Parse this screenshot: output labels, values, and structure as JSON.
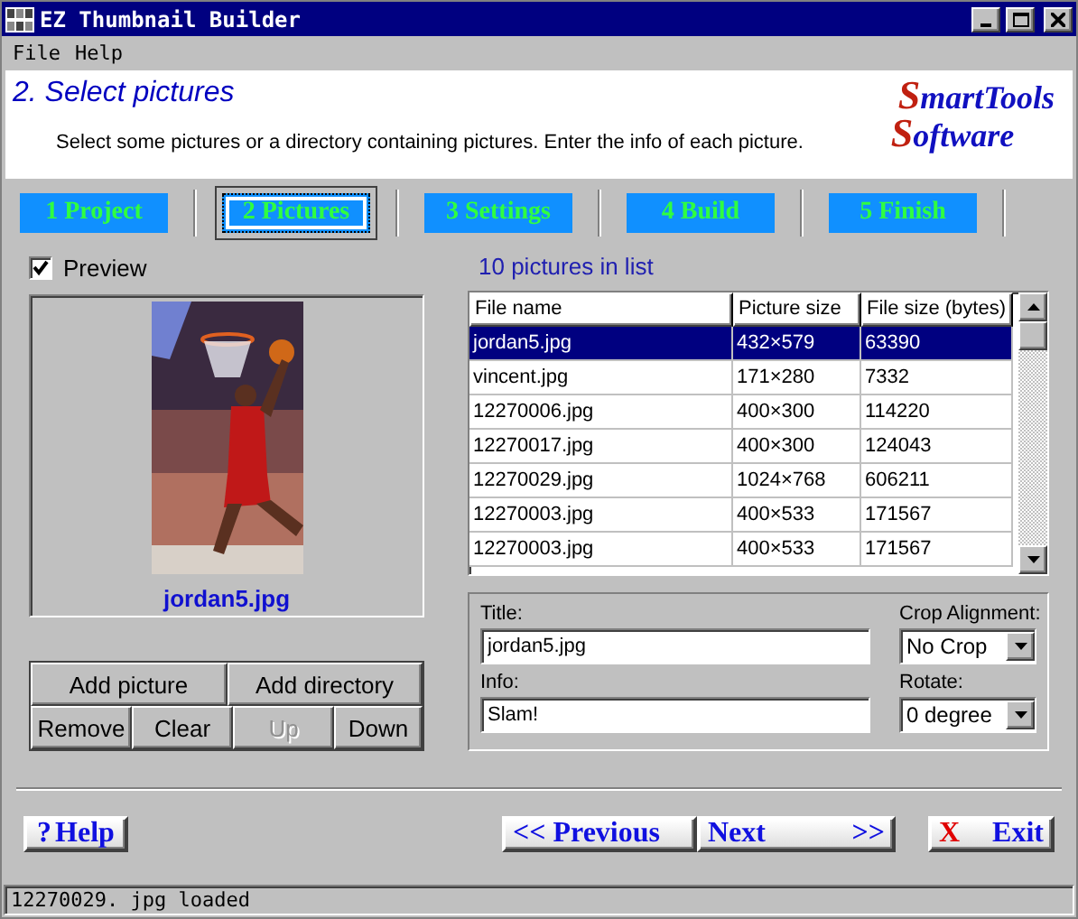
{
  "window": {
    "title": "EZ Thumbnail Builder"
  },
  "menu": [
    "File",
    "Help"
  ],
  "header": {
    "title": "2. Select pictures",
    "subtitle": "Select some pictures or a directory containing pictures. Enter the info of each picture.",
    "logo": [
      "SmartTools",
      "Software"
    ]
  },
  "tabs": [
    {
      "label": "1 Project",
      "selected": false
    },
    {
      "label": "2 Pictures",
      "selected": true
    },
    {
      "label": "3 Settings",
      "selected": false
    },
    {
      "label": "4 Build",
      "selected": false
    },
    {
      "label": "5 Finish",
      "selected": false
    }
  ],
  "preview": {
    "label": "Preview",
    "checked": true,
    "caption": "jordan5.jpg"
  },
  "list_buttons": [
    {
      "label": "Add picture",
      "disabled": false
    },
    {
      "label": "Add directory",
      "disabled": false
    }
  ],
  "order_buttons": [
    {
      "label": "Remove",
      "disabled": false
    },
    {
      "label": "Clear",
      "disabled": false
    },
    {
      "label": "Up",
      "disabled": true
    },
    {
      "label": "Down",
      "disabled": false
    }
  ],
  "count": "10 pictures in list",
  "table": {
    "columns": [
      "File name",
      "Picture size",
      "File size (bytes)"
    ],
    "rows": [
      {
        "cells": [
          "jordan5.jpg",
          "432×579",
          "63390"
        ],
        "selected": true
      },
      {
        "cells": [
          "vincent.jpg",
          "171×280",
          "7332"
        ],
        "selected": false
      },
      {
        "cells": [
          "12270006.jpg",
          "400×300",
          "114220"
        ],
        "selected": false
      },
      {
        "cells": [
          "12270017.jpg",
          "400×300",
          "124043"
        ],
        "selected": false
      },
      {
        "cells": [
          "12270029.jpg",
          "1024×768",
          "606211"
        ],
        "selected": false
      },
      {
        "cells": [
          "12270003.jpg",
          "400×533",
          "171567"
        ],
        "selected": false
      },
      {
        "cells": [
          "12270003.jpg",
          "400×533",
          "171567"
        ],
        "selected": false
      }
    ]
  },
  "form": {
    "title_label": "Title:",
    "title_value": "jordan5.jpg",
    "info_label": "Info:",
    "info_value": "Slam!",
    "crop_label": "Crop Alignment:",
    "crop_value": "No Crop",
    "rotate_label": "Rotate:",
    "rotate_value": "0 degree"
  },
  "nav": {
    "help": {
      "icon": "?",
      "label": "Help"
    },
    "previous": "<< Previous",
    "next": {
      "label": "Next",
      "arrow": ">>"
    },
    "exit": {
      "icon": "X",
      "label": "Exit"
    }
  },
  "status_bar": "12270029. jpg loaded"
}
